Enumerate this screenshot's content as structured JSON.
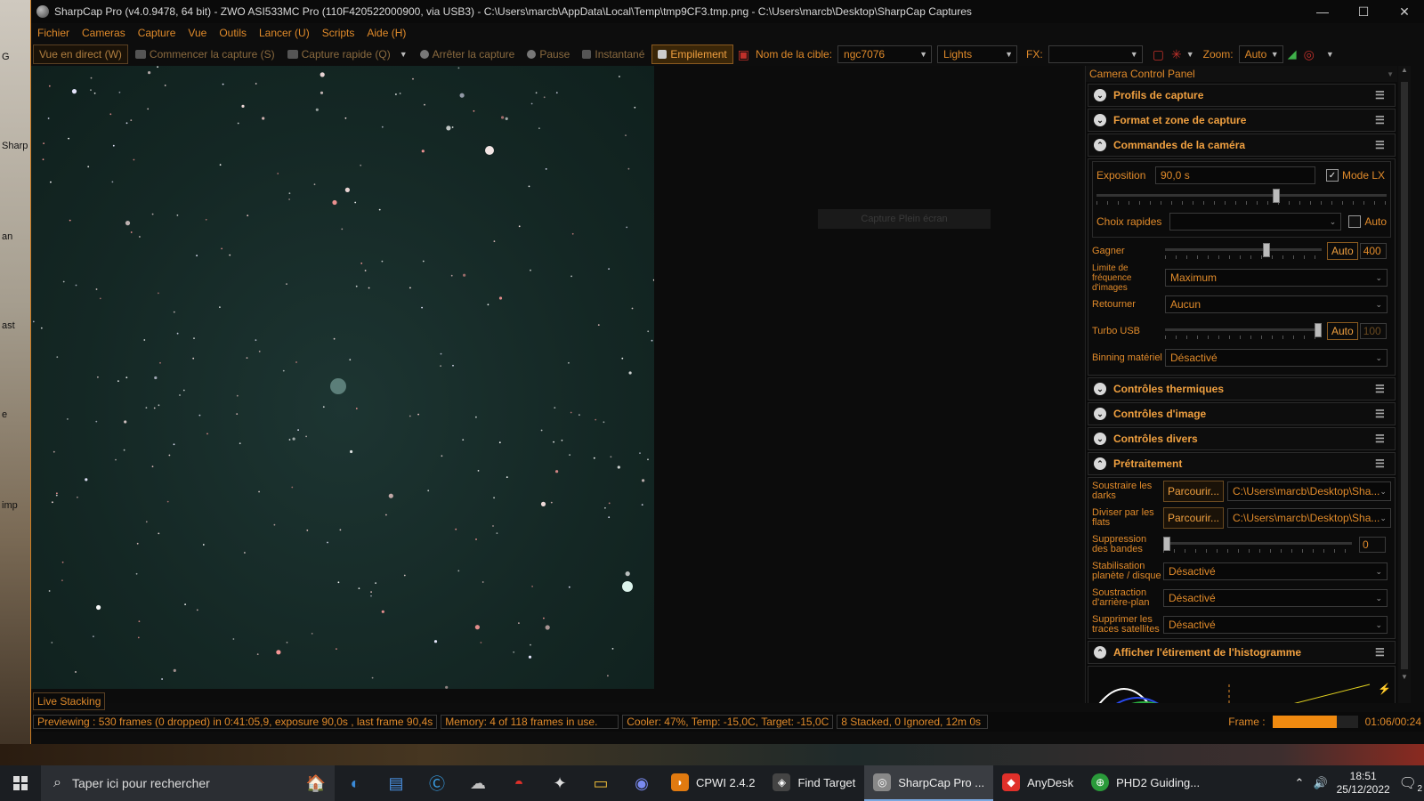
{
  "window": {
    "title": "SharpCap Pro (v4.0.9478, 64 bit) - ZWO ASI533MC Pro (110F420522000900, via USB3) - C:\\Users\\marcb\\AppData\\Local\\Temp\\tmp9CF3.tmp.png - C:\\Users\\marcb\\Desktop\\SharpCap Captures",
    "minimize": "—",
    "maximize": "☐",
    "close": "✕"
  },
  "menu": [
    "Fichier",
    "Cameras",
    "Capture",
    "Vue",
    "Outils",
    "Lancer (U)",
    "Scripts",
    "Aide (H)"
  ],
  "toolbar": {
    "live_view": "Vue en direct (W)",
    "start_capture": "Commencer la capture (S)",
    "quick_capture": "Capture rapide (Q)",
    "stop_capture": "Arrêter la capture",
    "pause": "Pause",
    "snapshot": "Instantané",
    "stacking": "Empilement",
    "target_label": "Nom de la cible:",
    "target_value": "ngc7076",
    "frame_type": "Lights",
    "fx_label": "FX:",
    "fx_value": "",
    "zoom_label": "Zoom:",
    "zoom_value": "Auto"
  },
  "image": {
    "capture_hint": "Capture Plein écran",
    "live_tab": "Live Stacking"
  },
  "panel": {
    "title": "Camera Control Panel",
    "sections": {
      "profiles": "Profils de capture",
      "format": "Format et zone de capture",
      "camera": "Commandes de la caméra",
      "thermal": "Contrôles thermiques",
      "image": "Contrôles d'image",
      "misc": "Contrôles divers",
      "preprocess": "Prétraitement",
      "histogram": "Afficher l'étirement de l'histogramme"
    },
    "camera": {
      "exposure_label": "Exposition",
      "exposure_value": "90,0 s",
      "lx_label": "Mode LX",
      "lx_checked": true,
      "exposure_slider": 0.62,
      "quick_label": "Choix rapides",
      "quick_value": "",
      "quick_auto": "Auto",
      "gain_label": "Gagner",
      "gain_slider": 0.65,
      "gain_auto": "Auto",
      "gain_value": "400",
      "fps_label": "Limite de fréquence d'images",
      "fps_value": "Maximum",
      "flip_label": "Retourner",
      "flip_value": "Aucun",
      "usb_label": "Turbo USB",
      "usb_slider": 0.98,
      "usb_auto": "Auto",
      "usb_value": "100",
      "binning_label": "Binning matériel",
      "binning_value": "Désactivé"
    },
    "preprocess": {
      "darks_label": "Soustraire les darks",
      "darks_browse": "Parcourir...",
      "darks_path": "C:\\Users\\marcb\\Desktop\\Sha...",
      "flats_label": "Diviser par les flats",
      "flats_browse": "Parcourir...",
      "flats_path": "C:\\Users\\marcb\\Desktop\\Sha...",
      "banding_label": "Suppression des bandes",
      "banding_value": "0",
      "stabilize_label": "Stabilisation planète / disque",
      "stabilize_value": "Désactivé",
      "background_label": "Soustraction d'arrière-plan",
      "background_value": "Désactivé",
      "satellite_label": "Supprimer les traces satellites",
      "satellite_value": "Désactivé"
    }
  },
  "status": {
    "previewing": "Previewing : 530 frames (0 dropped) in 0:41:05,9, exposure 90,0s , last frame 90,4s",
    "memory": "Memory: 4 of 118 frames in use.",
    "cooler": "Cooler: 47%, Temp: -15,0C, Target: -15,0C",
    "stacked": "8 Stacked, 0 Ignored, 12m 0s",
    "frame_label": "Frame :",
    "frame_progress": 0.75,
    "frame_time": "01:06/00:24"
  },
  "desktop": {
    "labels": [
      "G",
      "Sharp",
      "an",
      "ast",
      "e",
      "imp"
    ]
  },
  "taskbar": {
    "search_placeholder": "Taper ici pour rechercher",
    "tasks": [
      {
        "label": "CPWI 2.4.2",
        "color": "#e07a10"
      },
      {
        "label": "Find Target",
        "color": "#444"
      },
      {
        "label": "SharpCap Pro ...",
        "color": "#888"
      },
      {
        "label": "AnyDesk",
        "color": "#e0302a"
      },
      {
        "label": "PHD2 Guiding...",
        "color": "#2a9a3a"
      }
    ],
    "time": "18:51",
    "date": "25/12/2022",
    "notifications": "2"
  }
}
